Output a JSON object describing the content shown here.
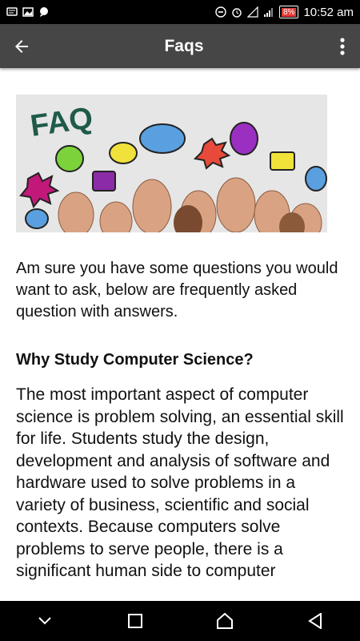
{
  "status": {
    "battery": "8%",
    "time": "10:52 am"
  },
  "appbar": {
    "title": "Faqs"
  },
  "banner": {
    "text": "FAQ"
  },
  "intro": "Am sure you have some questions you would want to ask, below are frequently asked question with answers.",
  "faq": [
    {
      "question": "Why Study Computer Science?",
      "answer": "The most important aspect of computer science is problem solving, an essential skill for life. Students study the design, development and analysis of software and hardware used to solve problems in a variety of business, scientific and social contexts. Because computers solve problems to serve people, there is a significant human side to computer"
    }
  ],
  "colors": {
    "appbar": "#464646",
    "status": "#000000",
    "accent_red": "#e53935"
  }
}
